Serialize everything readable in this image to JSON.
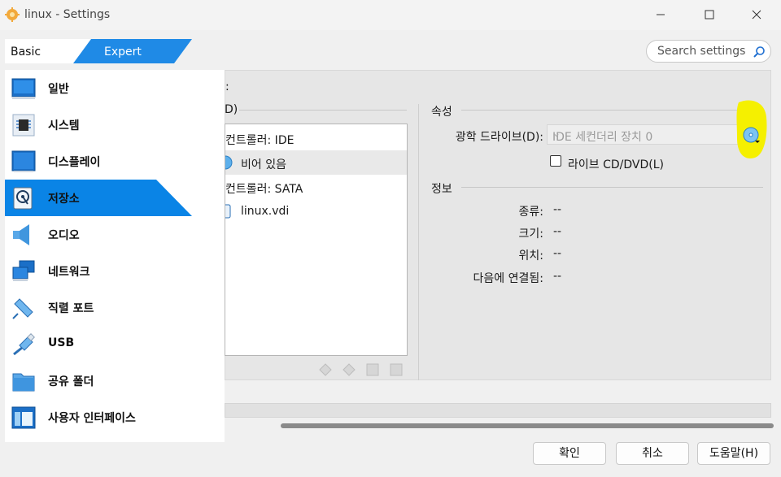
{
  "window": {
    "title": "linux - Settings"
  },
  "mode_tabs": {
    "basic": "Basic",
    "expert": "Expert"
  },
  "search": {
    "placeholder": "Search settings"
  },
  "sidebar": {
    "items": [
      {
        "label": "일반",
        "icon": "monitor-icon"
      },
      {
        "label": "시스템",
        "icon": "chip-icon"
      },
      {
        "label": "디스플레이",
        "icon": "display-icon"
      },
      {
        "label": "저장소",
        "icon": "storage-icon",
        "selected": true
      },
      {
        "label": "오디오",
        "icon": "speaker-icon"
      },
      {
        "label": "네트워크",
        "icon": "network-icon"
      },
      {
        "label": "직렬 포트",
        "icon": "serial-port-icon"
      },
      {
        "label": "USB",
        "icon": "usb-icon"
      },
      {
        "label": "공유 폴더",
        "icon": "folder-icon"
      },
      {
        "label": "사용자 인터페이스",
        "icon": "ui-window-icon"
      }
    ]
  },
  "storage": {
    "header_fragment": ":",
    "tree_header_fragment": "D)",
    "tree": [
      {
        "label": "컨트롤러: IDE"
      },
      {
        "label": "비어 있음"
      },
      {
        "label": "컨트롤러: SATA"
      },
      {
        "label": "linux.vdi"
      }
    ]
  },
  "attributes": {
    "section_title": "속성",
    "optical_drive_label": "광학 드라이브(D):",
    "optical_drive_value": "IDE 세컨더리 장치 0",
    "live_cd_label": "라이브 CD/DVD(L)",
    "live_cd_checked": false
  },
  "info": {
    "section_title": "정보",
    "rows": [
      {
        "label": "종류:",
        "value": "--"
      },
      {
        "label": "크기:",
        "value": "--"
      },
      {
        "label": "위치:",
        "value": "--"
      },
      {
        "label": "다음에 연결됨:",
        "value": "--"
      }
    ]
  },
  "buttons": {
    "ok": "확인",
    "cancel": "취소",
    "help": "도움말(H)"
  },
  "colors": {
    "accent": "#0a84e6",
    "highlight": "#f5f000",
    "tab_blue": "#1f8ae6"
  }
}
